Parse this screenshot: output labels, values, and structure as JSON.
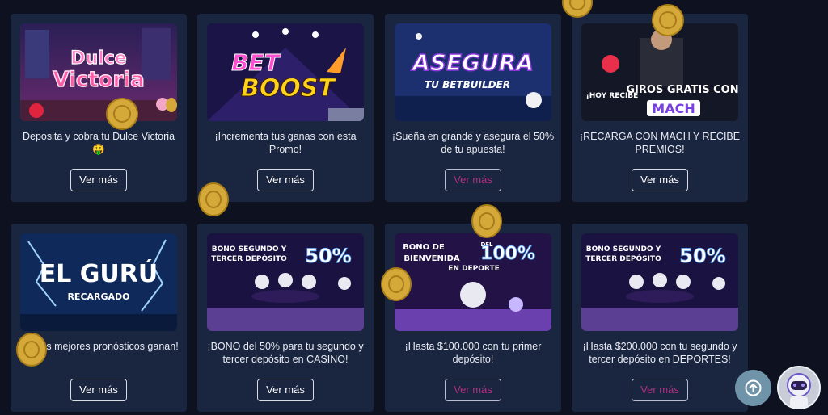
{
  "promos": [
    {
      "banner": [
        "Dulce",
        "Victoria"
      ],
      "desc": "Deposita y cobra tu Dulce Victoria 🤑",
      "button": "Ver más"
    },
    {
      "banner": [
        "BET",
        "BOOST"
      ],
      "desc": "¡Incrementa tus ganas con esta Promo!",
      "button": "Ver más"
    },
    {
      "banner": [
        "ASEGURA",
        "TU BETBUILDER"
      ],
      "desc": "¡Sueña en grande y asegura el 50% de tu apuesta!",
      "button": "Ver más"
    },
    {
      "banner": [
        "¡HOY RECIBE",
        "GIROS GRATIS CON",
        "MACH"
      ],
      "desc": "¡RECARGA CON MACH Y RECIBE PREMIOS!",
      "button": "Ver más"
    },
    {
      "banner": [
        "EL GURÚ",
        "RECARGADO"
      ],
      "desc": "nde los mejores pronósticos ganan!",
      "button": "Ver más"
    },
    {
      "banner": [
        "BONO SEGUNDO Y",
        "TERCER DEPÓSITO",
        "50%"
      ],
      "desc": "¡BONO del 50% para tu segundo y tercer depósito en CASINO!",
      "button": "Ver más"
    },
    {
      "banner": [
        "BONO DE",
        "BIENVENIDA",
        "DEL",
        "100%",
        "EN DEPORTE"
      ],
      "desc": "¡Hasta $100.000 con tu primer depósito!",
      "button": "Ver más"
    },
    {
      "banner": [
        "BONO SEGUNDO Y",
        "TERCER DEPÓSITO",
        "50%"
      ],
      "desc": "¡Hasta $200.000 con tu segundo y tercer depósito en DEPORTES!",
      "button": "Ver más"
    }
  ],
  "floating": {
    "scroll_top_icon": "arrow-up-icon",
    "assistant_avatar": "astronaut-avatar"
  },
  "colors": {
    "background": "#0e1220",
    "card": "#1a2540",
    "button_border": "#d9dde6",
    "dim_button_text": "#b1307f",
    "coin": "#d4a93a"
  }
}
